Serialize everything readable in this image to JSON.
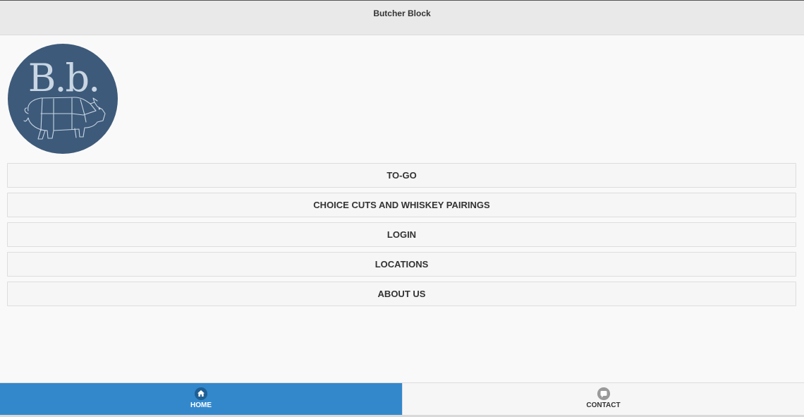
{
  "header": {
    "title": "Butcher Block"
  },
  "logo": {
    "text": "B.b.",
    "alt": "Butcher Block pig logo"
  },
  "nav": {
    "items": [
      {
        "label": "TO-GO"
      },
      {
        "label": "CHOICE CUTS AND WHISKEY PAIRINGS"
      },
      {
        "label": "LOGIN"
      },
      {
        "label": "LOCATIONS"
      },
      {
        "label": "ABOUT US"
      }
    ]
  },
  "tabbar": {
    "home": {
      "label": "HOME",
      "icon": "home-icon",
      "active": true
    },
    "contact": {
      "label": "CONTACT",
      "icon": "chat-icon",
      "active": false
    }
  },
  "colors": {
    "header_bg": "#e9e9e9",
    "active_tab": "#3388cc",
    "logo_circle": "#3d5a7a",
    "logo_lines": "#c9d6e3"
  }
}
